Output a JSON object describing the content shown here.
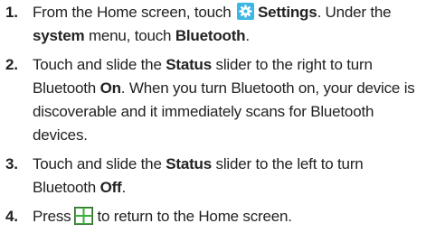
{
  "steps": [
    {
      "num": "1.",
      "a": "From the Home screen, touch",
      "icon": "settings-gear-icon",
      "b": "Settings",
      "c": ". Under the",
      "d": "system",
      "e": "menu, touch",
      "f": "Bluetooth",
      "g": "."
    },
    {
      "num": "2.",
      "a": "Touch and slide the",
      "b": "Status",
      "c": "slider to the right to turn Bluetooth",
      "d": "On",
      "e": ". When you turn Bluetooth on, your device is discoverable and it immediately scans for Bluetooth devices."
    },
    {
      "num": "3.",
      "a": "Touch and slide the",
      "b": "Status",
      "c": "slider to the left to turn Bluetooth",
      "d": "Off",
      "e": "."
    },
    {
      "num": "4.",
      "a": "Press",
      "icon": "windows-start-icon",
      "b": "to return to the Home screen."
    }
  ],
  "colors": {
    "text": "#222222",
    "settings_icon_bg": "#3db6e6",
    "windows_icon_bg": "#3cae3a"
  }
}
